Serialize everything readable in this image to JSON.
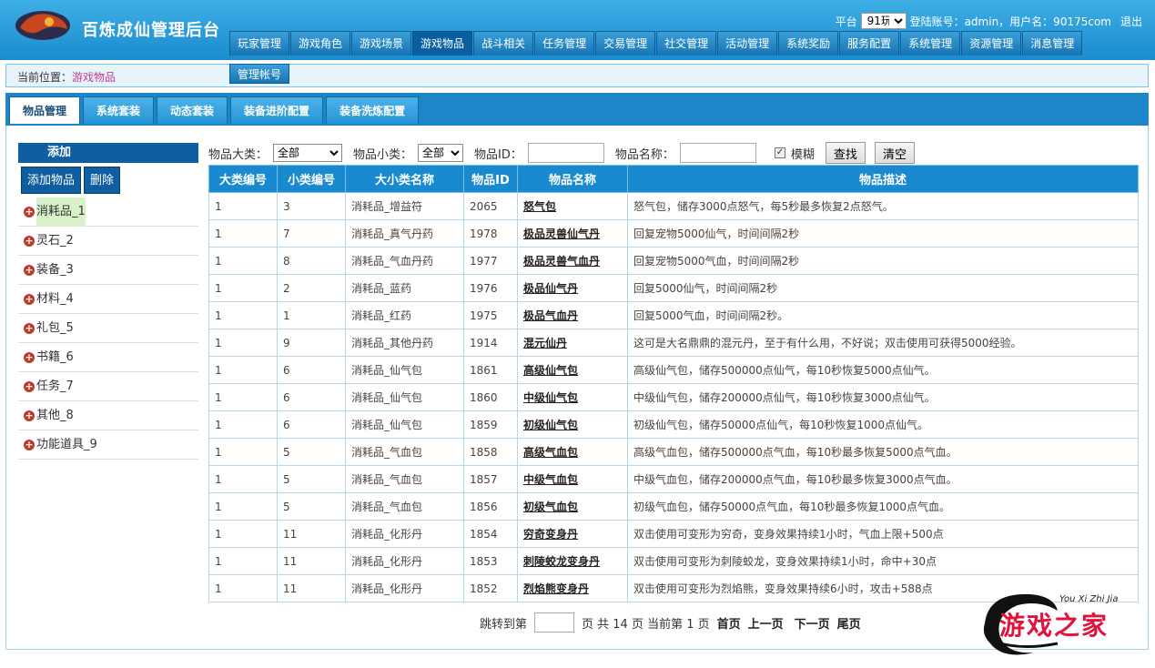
{
  "header": {
    "app_title": "百炼成仙管理后台",
    "platform_label": "平台",
    "platform_value": "91玩",
    "login_info": "登陆账号：admin，用户名：90175com",
    "logout_label": "退出",
    "nav_tabs": [
      "玩家管理",
      "游戏角色",
      "游戏场景",
      "游戏物品",
      "战斗相关",
      "任务管理",
      "交易管理",
      "社交管理",
      "活动管理",
      "系统奖励",
      "服务配置",
      "系统管理",
      "资源管理",
      "消息管理"
    ],
    "active_nav": "游戏物品",
    "sub_nav": "管理帐号"
  },
  "breadcrumb": {
    "prefix": "当前位置：",
    "current": "游戏物品"
  },
  "page_tabs": [
    "物品管理",
    "系统套装",
    "动态套装",
    "装备进阶配置",
    "装备洗炼配置"
  ],
  "left_panel": {
    "header": "添加",
    "add_button": "添加物品",
    "delete_button": "删除",
    "categories": [
      "消耗品_1",
      "灵石_2",
      "装备_3",
      "材料_4",
      "礼包_5",
      "书籍_6",
      "任务_7",
      "其他_8",
      "功能道具_9"
    ]
  },
  "filters": {
    "major_label": "物品大类：",
    "major_value": "全部",
    "minor_label": "物品小类：",
    "minor_value": "全部",
    "id_label": "物品ID：",
    "name_label": "物品名称：",
    "fuzzy_label": "模糊",
    "search_button": "查找",
    "clear_button": "清空"
  },
  "table": {
    "headers": [
      "大类编号",
      "小类编号",
      "大小类名称",
      "物品ID",
      "物品名称",
      "物品描述"
    ],
    "rows": [
      [
        "1",
        "3",
        "消耗品_增益符",
        "2065",
        "怒气包",
        "怒气包，储存3000点怒气，每5秒最多恢复2点怒气。"
      ],
      [
        "1",
        "7",
        "消耗品_真气丹药",
        "1978",
        "极品灵兽仙气丹",
        "回复宠物5000仙气，时间间隔2秒"
      ],
      [
        "1",
        "8",
        "消耗品_气血丹药",
        "1977",
        "极品灵兽气血丹",
        "回复宠物5000气血，时间间隔2秒"
      ],
      [
        "1",
        "2",
        "消耗品_蓝药",
        "1976",
        "极品仙气丹",
        "回复5000仙气，时间间隔2秒"
      ],
      [
        "1",
        "1",
        "消耗品_红药",
        "1975",
        "极品气血丹",
        "回复5000气血，时间间隔2秒。"
      ],
      [
        "1",
        "9",
        "消耗品_其他丹药",
        "1914",
        "混元仙丹",
        "这可是大名鼎鼎的混元丹，至于有什么用，不好说；双击使用可获得5000经验。"
      ],
      [
        "1",
        "6",
        "消耗品_仙气包",
        "1861",
        "高级仙气包",
        "高级仙气包，储存500000点仙气，每10秒恢复5000点仙气。"
      ],
      [
        "1",
        "6",
        "消耗品_仙气包",
        "1860",
        "中级仙气包",
        "中级仙气包，储存200000点仙气，每10秒恢复3000点仙气。"
      ],
      [
        "1",
        "6",
        "消耗品_仙气包",
        "1859",
        "初级仙气包",
        "初级仙气包，储存50000点仙气，每10秒恢复1000点仙气。"
      ],
      [
        "1",
        "5",
        "消耗品_气血包",
        "1858",
        "高级气血包",
        "高级气血包，储存500000点气血，每10秒最多恢复5000点气血。"
      ],
      [
        "1",
        "5",
        "消耗品_气血包",
        "1857",
        "中级气血包",
        "中级气血包，储存200000点气血，每10秒最多恢复3000点气血。"
      ],
      [
        "1",
        "5",
        "消耗品_气血包",
        "1856",
        "初级气血包",
        "初级气血包，储存50000点气血，每10秒最多恢复1000点气血。"
      ],
      [
        "1",
        "11",
        "消耗品_化形丹",
        "1854",
        "穷奇变身丹",
        "双击使用可变形为穷奇，变身效果持续1小时，气血上限+500点"
      ],
      [
        "1",
        "11",
        "消耗品_化形丹",
        "1853",
        "刺陵蛟龙变身丹",
        "双击使用可变形为刺陵蛟龙，变身效果持续1小时，命中+30点"
      ],
      [
        "1",
        "11",
        "消耗品_化形丹",
        "1852",
        "烈焰熊变身丹",
        "双击使用可变形为烈焰熊，变身效果持续6小时，攻击+588点"
      ]
    ]
  },
  "pager": {
    "jump_label": "跳转到第",
    "summary": "页 共 14 页 当前第 1 页",
    "first": "首页",
    "prev": "上一页",
    "next": "下一页",
    "last": "尾页"
  },
  "watermark": {
    "text": "游戏之家",
    "sub": "You Xi Zhi Jia"
  }
}
